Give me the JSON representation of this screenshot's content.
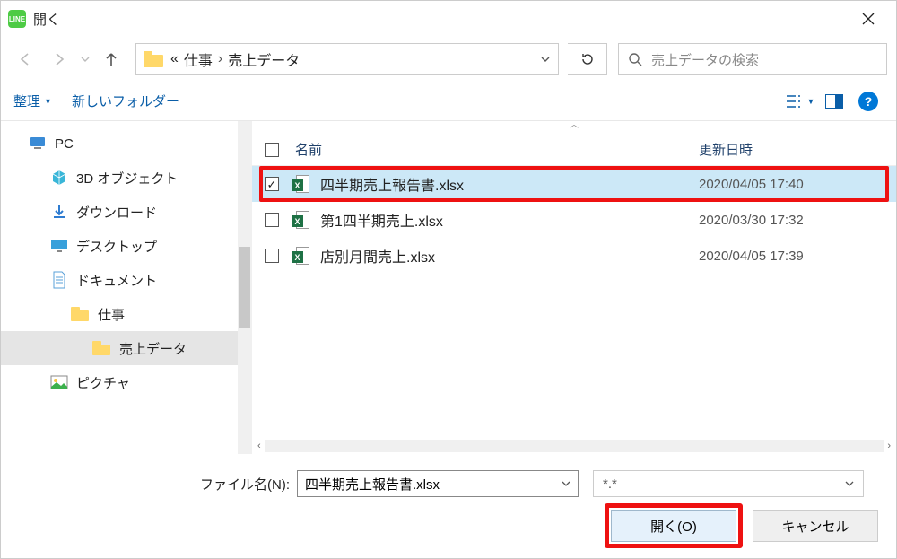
{
  "title": "開く",
  "breadcrumb": {
    "prefix": "«",
    "items": [
      "仕事",
      "売上データ"
    ]
  },
  "search": {
    "placeholder": "売上データの検索"
  },
  "toolbar": {
    "organize": "整理",
    "newfolder": "新しいフォルダー"
  },
  "columns": {
    "name": "名前",
    "date": "更新日時"
  },
  "files": [
    {
      "name": "四半期売上報告書.xlsx",
      "date": "2020/04/05 17:40",
      "checked": true,
      "selected": true,
      "highlight": true
    },
    {
      "name": "第1四半期売上.xlsx",
      "date": "2020/03/30 17:32",
      "checked": false,
      "selected": false,
      "highlight": false
    },
    {
      "name": "店別月間売上.xlsx",
      "date": "2020/04/05 17:39",
      "checked": false,
      "selected": false,
      "highlight": false
    }
  ],
  "sidebar": [
    {
      "label": "PC",
      "indent": 30,
      "icon": "pc",
      "selected": false
    },
    {
      "label": "3D オブジェクト",
      "indent": 54,
      "icon": "3d",
      "selected": false
    },
    {
      "label": "ダウンロード",
      "indent": 54,
      "icon": "download",
      "selected": false
    },
    {
      "label": "デスクトップ",
      "indent": 54,
      "icon": "desktop",
      "selected": false
    },
    {
      "label": "ドキュメント",
      "indent": 54,
      "icon": "document",
      "selected": false
    },
    {
      "label": "仕事",
      "indent": 78,
      "icon": "folder",
      "selected": false
    },
    {
      "label": "売上データ",
      "indent": 102,
      "icon": "folder",
      "selected": true
    },
    {
      "label": "ピクチャ",
      "indent": 54,
      "icon": "pictures",
      "selected": false
    }
  ],
  "footer": {
    "filename_label": "ファイル名(N):",
    "filename_value": "四半期売上報告書.xlsx",
    "filter_value": "*.*",
    "open": "開く(O)",
    "cancel": "キャンセル"
  }
}
